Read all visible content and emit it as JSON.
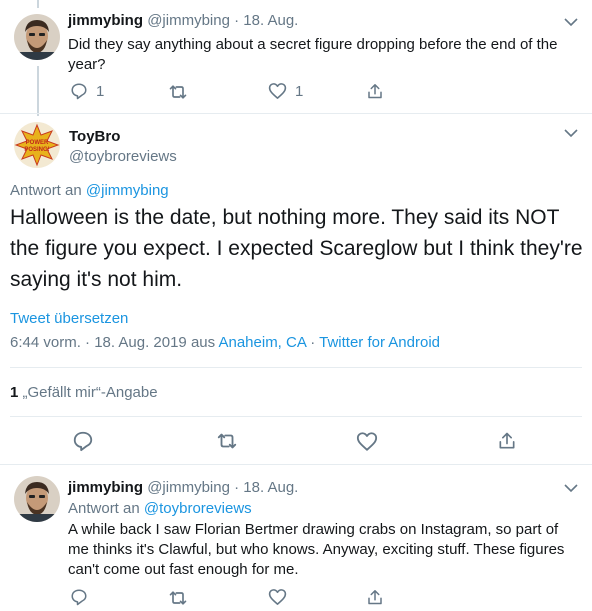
{
  "tweet1": {
    "display_name": "jimmybing",
    "handle": "@jimmybing",
    "separator": "·",
    "date": "18. Aug.",
    "text": "Did they say anything about a secret figure dropping before the end of the year?",
    "reply_count": "1",
    "like_count": "1"
  },
  "main": {
    "display_name": "ToyBro",
    "handle": "@toybroreviews",
    "avatar_text": "POWER POSING!",
    "reply_prefix": "Antwort an",
    "reply_to": "@jimmybing",
    "text": "Halloween is the date, but nothing more. They said its NOT the figure you expect. I expected Scareglow but I think they're saying it's not him.",
    "translate": "Tweet übersetzen",
    "time_date": "6:44 vorm. · 18. Aug. 2019 aus",
    "location": "Anaheim, CA",
    "meta_sep": "·",
    "client": "Twitter for Android",
    "likes_count": "1",
    "likes_label": "„Gefällt mir“-Angabe"
  },
  "tweet3": {
    "display_name": "jimmybing",
    "handle": "@jimmybing",
    "separator": "·",
    "date": "18. Aug.",
    "reply_prefix": "Antwort an",
    "reply_to": "@toybroreviews",
    "text": "A while back I saw Florian Bertmer drawing crabs on Instagram, so part of me thinks it's Clawful, but who knows. Anyway, exciting stuff. These figures can't come out fast enough for me."
  },
  "colors": {
    "accent": "#1b95e0",
    "muted": "#657786",
    "divider": "#e6ecf0"
  }
}
